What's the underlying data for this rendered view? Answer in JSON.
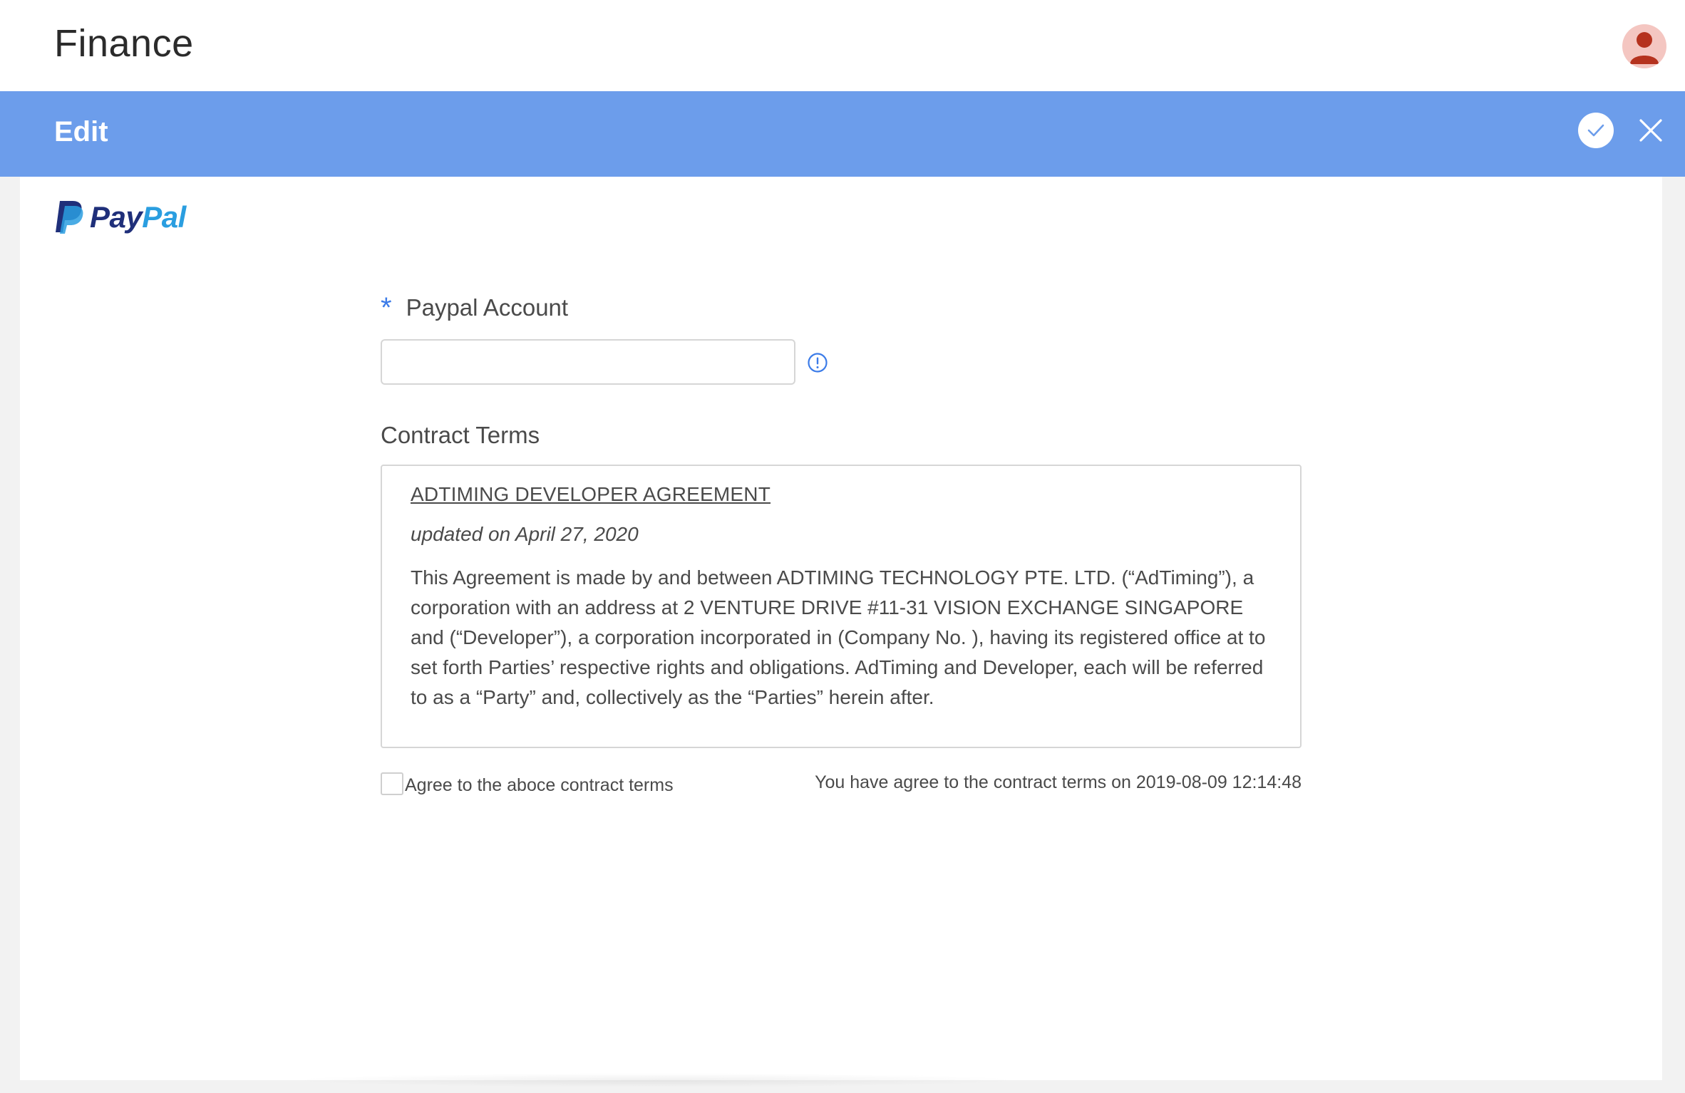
{
  "header": {
    "app_title": "Finance",
    "avatar_icon": "user-avatar-icon"
  },
  "edit_bar": {
    "title": "Edit",
    "confirm_icon": "check-circle-icon",
    "close_icon": "close-icon"
  },
  "brand": {
    "logo_pay": "Pay",
    "logo_pal": "Pal",
    "colors": {
      "pay": "#1f2f7a",
      "pal": "#2a9ee0"
    }
  },
  "form": {
    "required_mark": "*",
    "account_label": "Paypal Account",
    "account_value": "",
    "account_placeholder": "",
    "info_icon": "info-circle-icon",
    "terms_label": "Contract Terms",
    "terms": {
      "heading": "ADTIMING DEVELOPER AGREEMENT",
      "updated": "updated on April 27, 2020",
      "body": "This Agreement is made by and between ADTIMING TECHNOLOGY PTE. LTD. (“AdTiming”), a corporation with an address at 2 VENTURE DRIVE #11-31 VISION EXCHANGE SINGAPORE and (“Developer”), a corporation incorporated in (Company No. ), having its registered office at to set forth Parties’ respective rights and obligations. AdTiming and Developer, each will be referred to as a “Party” and, collectively as the “Parties” herein after."
    },
    "agree_label": "Agree to the aboce contract terms",
    "agree_checked": false,
    "agree_status": "You have agree to the contract terms on 2019-08-09 12:14:48"
  },
  "colors": {
    "edit_bar": "#6c9deb",
    "accent": "#3b7be8"
  }
}
